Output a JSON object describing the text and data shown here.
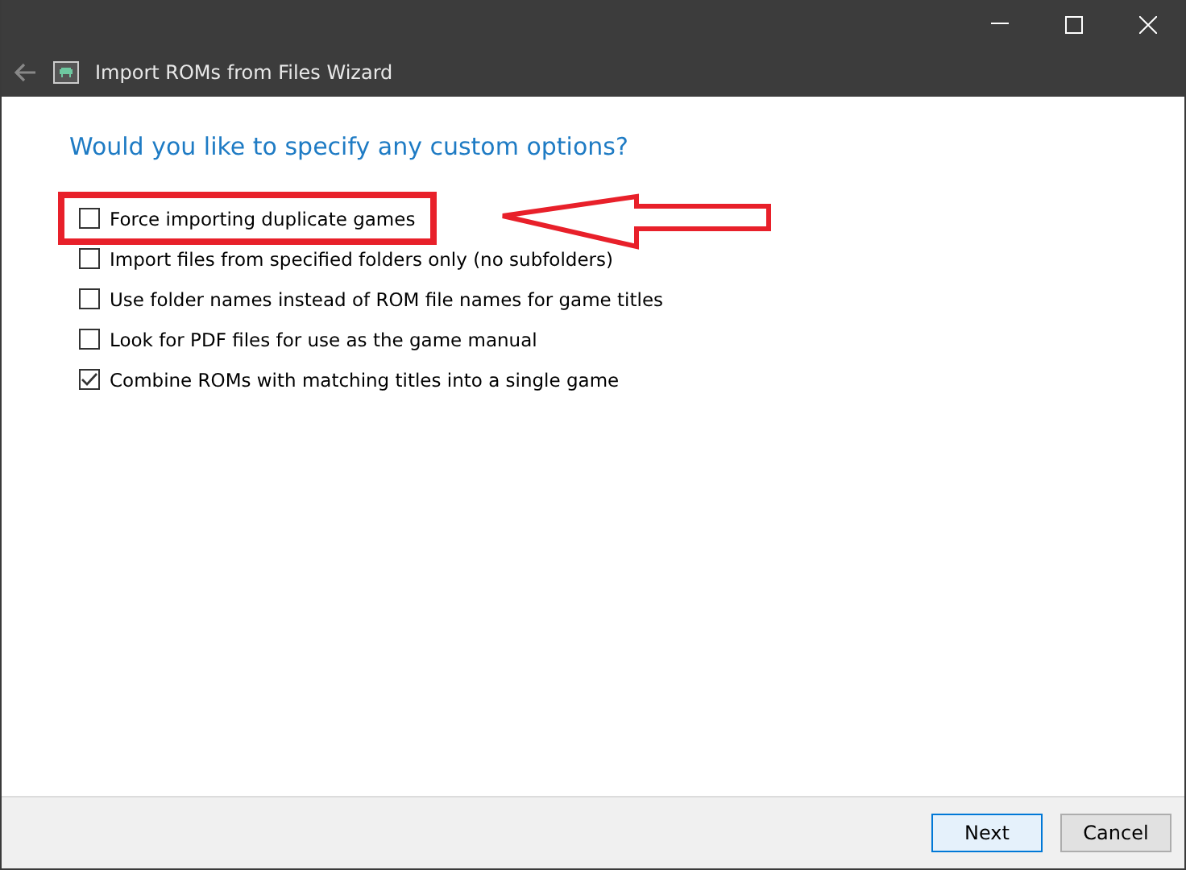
{
  "window": {
    "title": "Import ROMs from Files Wizard"
  },
  "heading": "Would you like to specify any custom options?",
  "options": [
    {
      "label": "Force importing duplicate games",
      "checked": false,
      "highlighted": true
    },
    {
      "label": "Import files from specified folders only (no subfolders)",
      "checked": false,
      "highlighted": false
    },
    {
      "label": "Use folder names instead of ROM file names for game titles",
      "checked": false,
      "highlighted": false
    },
    {
      "label": "Look for PDF files for use as the game manual",
      "checked": false,
      "highlighted": false
    },
    {
      "label": "Combine ROMs with matching titles into a single game",
      "checked": true,
      "highlighted": false
    }
  ],
  "annotation": {
    "kind": "arrow"
  },
  "buttons": [
    {
      "label": "Next",
      "selected": true
    },
    {
      "label": "Cancel",
      "selected": false
    }
  ]
}
